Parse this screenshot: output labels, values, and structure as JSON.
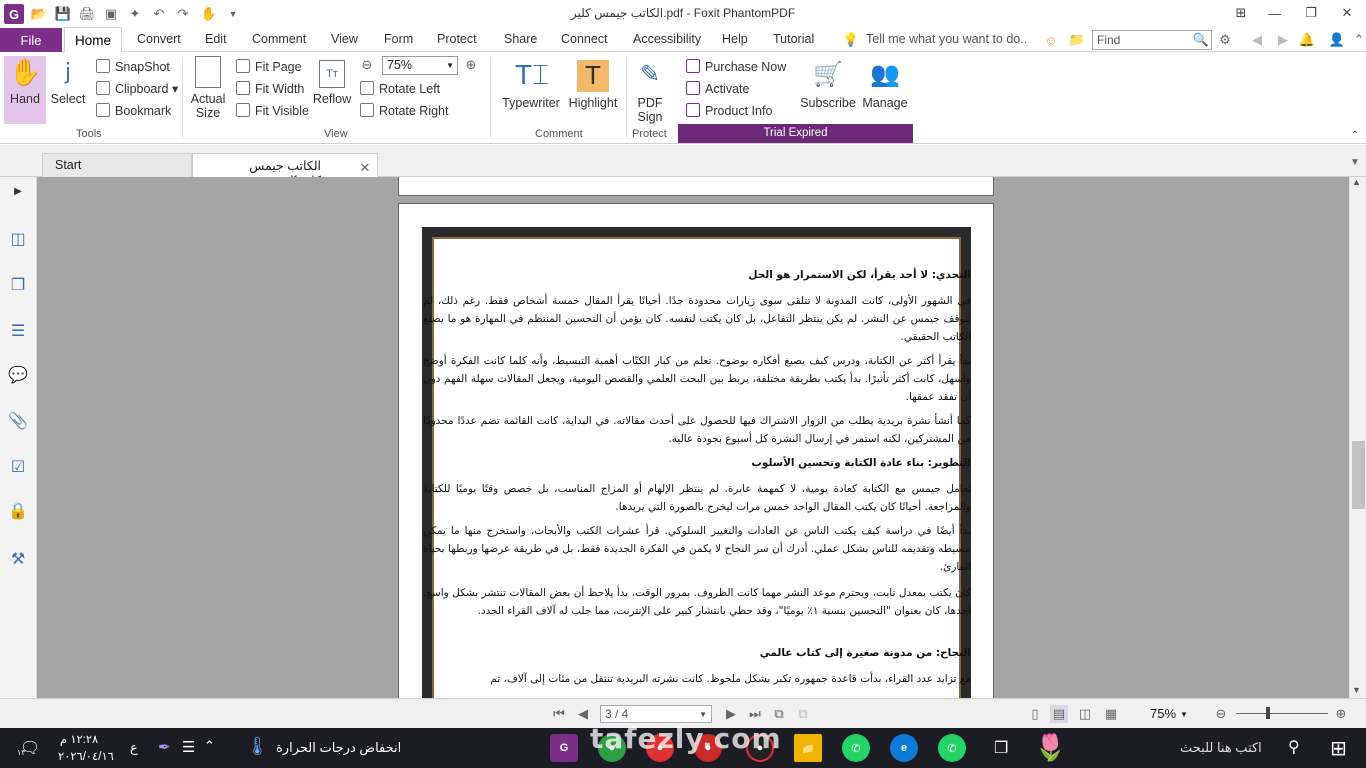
{
  "window": {
    "title": "الكاتب جيمس كلير.pdf - Foxit PhantomPDF",
    "app_icon": "G"
  },
  "menu": {
    "file": "File",
    "tabs": [
      "Home",
      "Convert",
      "Edit",
      "Comment",
      "View",
      "Form",
      "Protect",
      "Share",
      "Connect",
      "Accessibility",
      "Help",
      "Tutorial"
    ],
    "active_tab": "Home",
    "tell_me": "Tell me what you want to do..",
    "find_placeholder": "Find"
  },
  "ribbon": {
    "tools": {
      "hand": "Hand",
      "select": "Select",
      "snapshot": "SnapShot",
      "clipboard": "Clipboard",
      "bookmark": "Bookmark",
      "label": "Tools"
    },
    "view": {
      "actual_size_1": "Actual",
      "actual_size_2": "Size",
      "fit_page": "Fit Page",
      "fit_width": "Fit Width",
      "fit_visible": "Fit Visible",
      "reflow": "Reflow",
      "zoom_value": "75%",
      "rotate_left": "Rotate Left",
      "rotate_right": "Rotate Right",
      "label": "View"
    },
    "comment": {
      "typewriter": "Typewriter",
      "highlight": "Highlight",
      "label": "Comment"
    },
    "protect": {
      "pdf_sign_1": "PDF",
      "pdf_sign_2": "Sign",
      "label": "Protect"
    },
    "trial": {
      "purchase": "Purchase Now",
      "activate": "Activate",
      "product_info": "Product Info",
      "subscribe": "Subscribe",
      "manage": "Manage",
      "label": "Trial Expired"
    }
  },
  "doc_tabs": {
    "start": "Start",
    "file": "الكاتب جيمس كلير.pdf"
  },
  "document": {
    "paragraphs": [
      {
        "type": "heading",
        "text": "التحدي: لا أحد يقرأ، لكن الاستمرار هو الحل"
      },
      {
        "type": "body",
        "text": "في الشهور الأولى، كانت المدونة لا تتلقى سوى زيارات محدودة جدًا. أحيانًا يقرأ المقال خمسة أشخاص فقط. رغم ذلك، لم يتوقف جيمس عن النشر. لم يكن ينتظر التفاعل، بل كان يكتب لنفسه. كان يؤمن أن التحسين المنتظم في المهارة هو ما يصنع الكاتب الحقيقي."
      },
      {
        "type": "body",
        "text": "بدأ يقرأ أكثر عن الكتابة، ودرس كيف يصيغ أفكاره بوضوح. تعلم من كبار الكتّاب أهمية التبسيط، وأنه كلما كانت الفكرة أوضح وأسهل، كانت أكثر تأثيرًا. بدأ يكتب بطريقة مختلفة، يربط بين البحث العلمي والقصص اليومية، ويجعل المقالات سهلة الفهم دون أن تفقد عمقها."
      },
      {
        "type": "body",
        "text": "كما أنشأ نشرة بريدية يطلب من الزوار الاشتراك فيها للحصول على أحدث مقالاته. في البداية، كانت القائمة تضم عددًا محدودًا من المشتركين، لكنه استمر في إرسال النشرة كل أسبوع بجودة عالية."
      },
      {
        "type": "heading",
        "text": "التطوير: بناء عادة الكتابة وتحسين الأسلوب"
      },
      {
        "type": "body",
        "text": "تعامل جيمس مع الكتابة كعادة يومية، لا كمهمة عابرة. لم ينتظر الإلهام أو المزاج المناسب، بل خصص وقتًا يوميًا للكتابة والمراجعة. أحيانًا كان يكتب المقال الواحد خمس مرات ليخرج بالصورة التي يريدها."
      },
      {
        "type": "body",
        "text": "بدأ أيضًا في دراسة كيف يكتب الناس عن العادات والتغيير السلوكي. قرأ عشرات الكتب والأبحاث، واستخرج منها ما يمكن تبسيطه وتقديمه للناس بشكل عملي. أدرك أن سر النجاح لا يكمن في الفكرة الجديدة فقط، بل في طريقة عرضها وربطها بحياة القارئ."
      },
      {
        "type": "body",
        "text": "كان يكتب بمعدل ثابت، ويحترم موعد النشر مهما كانت الظروف. بمرور الوقت، بدأ يلاحظ أن بعض المقالات تنتشر بشكل واسع. أحدها، كان بعنوان \"التحسين بنسبة ١٪ يوميًا\"، وقد حظي بانتشار كبير على الإنترنت، مما جلب له آلاف القراء الجدد."
      },
      {
        "type": "heading",
        "text": "النجاح: من مدونة صغيرة إلى كتاب عالمي"
      },
      {
        "type": "body",
        "text": "مع تزايد عدد القراء، بدأت قاعدة جمهوره تكبر بشكل ملحوظ. كانت نشرته البريدية تنتقل من مئات إلى آلاف، ثم"
      }
    ]
  },
  "statusbar": {
    "page": "3 / 4",
    "zoom": "75%"
  },
  "taskbar": {
    "search": "اكتب هنا للبحث",
    "weather": "انخفاض درجات الحرارة",
    "time": "١٢:٢٨ م",
    "date": "٢٠٢٦/٠٤/١٦",
    "lang": "ع",
    "notif_count": "١٣",
    "watermark": "tafezly.com"
  },
  "colors": {
    "brand": "#7b2f86",
    "trial": "#6c2a78",
    "canvas": "#a5a5a5",
    "taskbar": "#1c1c24"
  }
}
